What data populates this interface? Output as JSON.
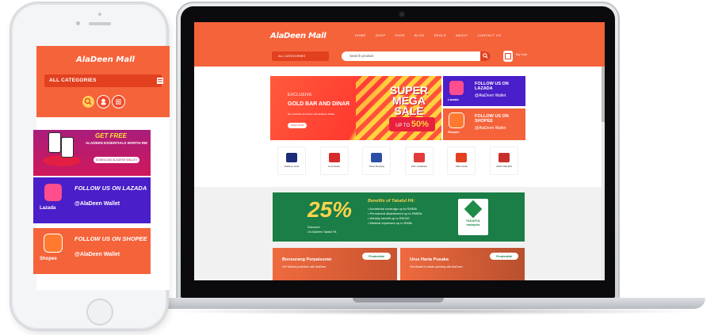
{
  "colors": {
    "brand_orange": "#f5633a",
    "brand_dark_orange": "#e2401f",
    "lazada_purple": "#4a1ec8",
    "takaful_green": "#1a7e46",
    "sale_yellow": "#ffd23e"
  },
  "laptop_site": {
    "logo": "AlaDeen Mall",
    "nav": [
      "HOME",
      "SHOP",
      "PAGE",
      "BLOG",
      "DEALS",
      "ABOUT",
      "CONTACT US"
    ],
    "all_categories": "ALL CATEGORIES",
    "search": {
      "placeholder": "Search product",
      "icon": "search-icon"
    },
    "cart": {
      "icon": "cart-icon",
      "label": "My Cart"
    },
    "hero": {
      "kicker": "EXCLUSIVE",
      "title": "GOLD BAR AND DINAR",
      "description": "Buy Gold Bar and Dinar with AlaDeen Wallet",
      "button": "SHOP NOW",
      "sale_line1": "SUPER",
      "sale_line2": "MEGA",
      "sale_line3": "SALE",
      "up_to": "UP TO",
      "percent": "50%"
    },
    "side_banners": [
      {
        "brand": "Lazada",
        "title": "FOLLOW US ON LAZADA",
        "subtitle": "@AlaDeen Wallet",
        "icon": "lazada-heart-icon"
      },
      {
        "brand": "Shopee",
        "title": "FOLLOW US ON SHOPEE",
        "subtitle": "@AlaDeen Wallet",
        "icon": "shopee-bag-icon"
      }
    ],
    "shop_icons": [
      {
        "label": "AlaDeen Gold",
        "color": "#1b2d7a"
      },
      {
        "label": "Fuel Deals",
        "color": "#d62b2b"
      },
      {
        "label": "Ticket Booking",
        "color": "#2b4fa8"
      },
      {
        "label": "10% Cashback",
        "color": "#e23b3b"
      },
      {
        "label": "Offer Deals",
        "color": "#e2401f"
      },
      {
        "label": "JAMU DELIMA",
        "color": "#c7302a"
      }
    ],
    "takaful": {
      "percent": "25%",
      "discount": "Discount",
      "on": "On AlaDeen Takaful PA",
      "benefits_title": "Benefits of Takaful PA:",
      "benefits": [
        "• Accidental coverage up to RM50k",
        "• Permanent disablement up to RM50k",
        "• Weekly benefit up to RM150",
        "• Medical expenses up to RM5k"
      ],
      "logo_text": "TAKAFUL malaysia"
    },
    "promos": [
      {
        "title": "Bonsurang Perpaisuran",
        "subtitle": "Get Takaful protection with AlaDeen",
        "badge": "Prudential"
      },
      {
        "title": "Urus Harta Pusaka",
        "subtitle": "Get Wasiat & estate planning with AlaDeen",
        "badge": "Prudential"
      }
    ]
  },
  "phone_site": {
    "logo": "AlaDeen Mall",
    "all_categories": "ALL CATEGORIES",
    "icons": [
      "search-icon",
      "user-icon",
      "menu-icon"
    ],
    "banner_free": {
      "title": "GET FREE",
      "subtitle": "ALADEEN ESSENTIALS WORTH RM",
      "button": "DOWNLOAD ALADEEN WALLET"
    },
    "banner_lazada": {
      "brand": "Lazada",
      "title": "FOLLOW US ON LAZADA",
      "subtitle": "@AlaDeen Wallet"
    },
    "banner_shopee": {
      "brand": "Shopee",
      "title": "FOLLOW US ON SHOPEE",
      "subtitle": "@AlaDeen Wallet"
    }
  }
}
